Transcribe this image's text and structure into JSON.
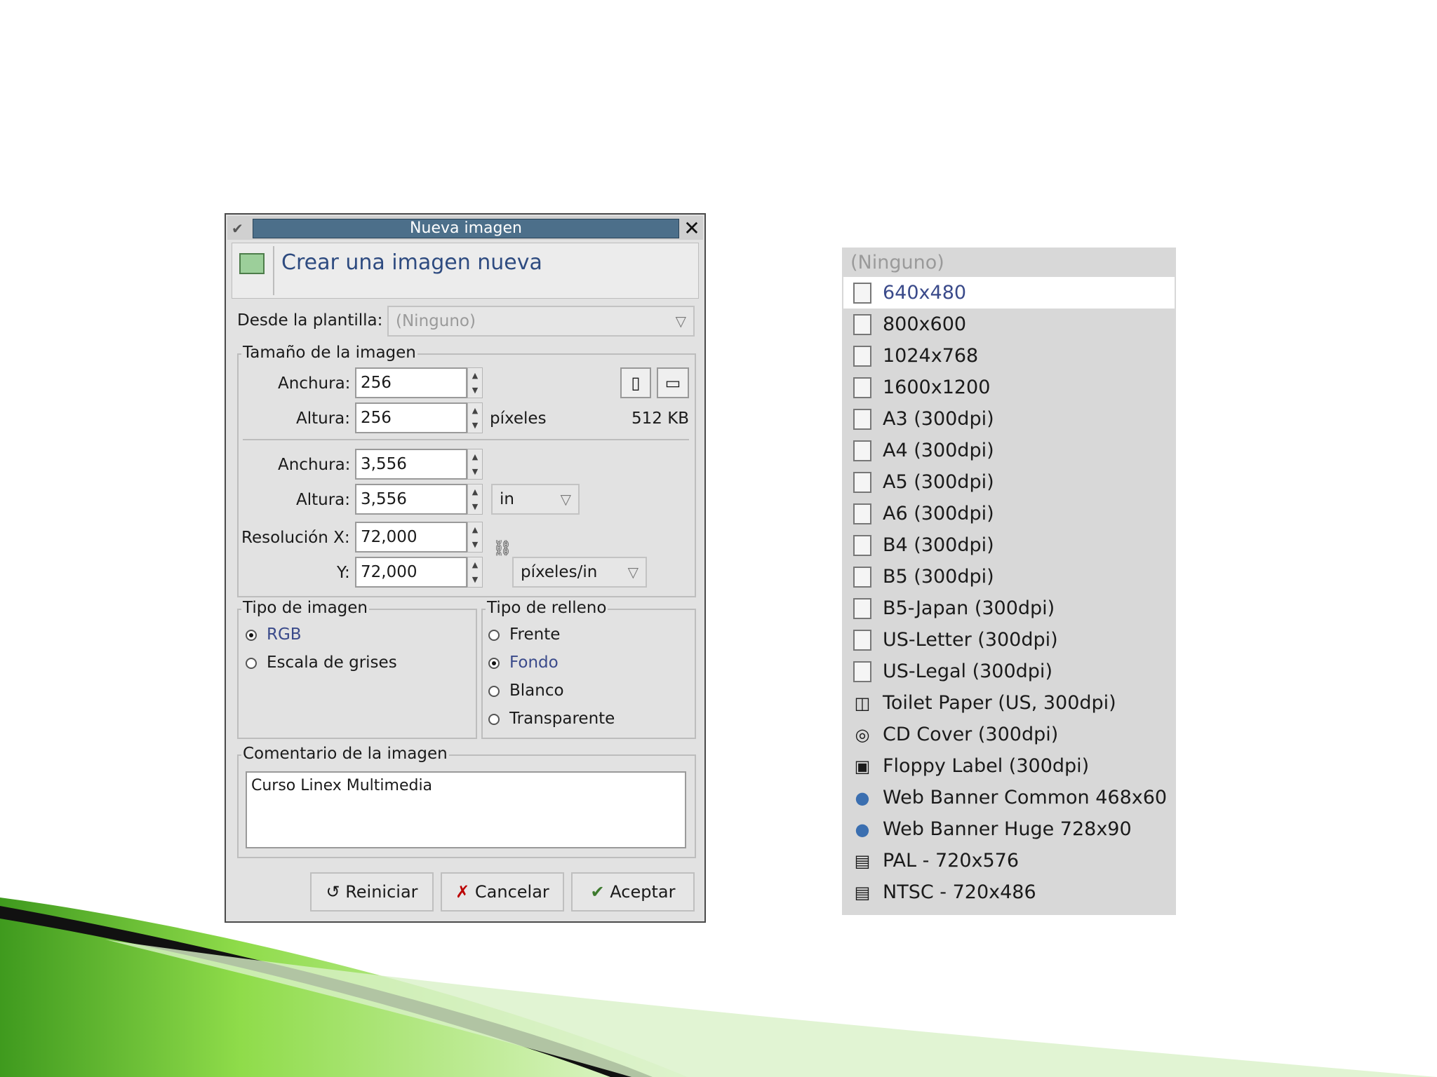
{
  "dialog": {
    "window_title": "Nueva imagen",
    "header_title": "Crear una imagen nueva",
    "template": {
      "label": "Desde la plantilla:",
      "value": "(Ninguno)"
    },
    "size_group": {
      "title": "Tamaño de la imagen",
      "width_label": "Anchura:",
      "width_value": "256",
      "height_label": "Altura:",
      "height_value": "256",
      "pixels_unit": "píxeles",
      "memory": "512 KB",
      "width2_label": "Anchura:",
      "width2_value": "3,556",
      "height2_label": "Altura:",
      "height2_value": "3,556",
      "unit": "in",
      "res_x_label": "Resolución X:",
      "res_x_value": "72,000",
      "res_y_label": "Y:",
      "res_y_value": "72,000",
      "res_unit": "píxeles/in"
    },
    "image_type": {
      "title": "Tipo de imagen",
      "options": [
        "RGB",
        "Escala de grises"
      ],
      "selected": "RGB"
    },
    "fill_type": {
      "title": "Tipo de relleno",
      "options": [
        "Frente",
        "Fondo",
        "Blanco",
        "Transparente"
      ],
      "selected": "Fondo"
    },
    "comment": {
      "title": "Comentario de la imagen",
      "value": "Curso Linex Multimedia"
    },
    "buttons": {
      "reset": "Reiniciar",
      "cancel": "Cancelar",
      "ok": "Aceptar"
    }
  },
  "template_list": {
    "header": "(Ninguno)",
    "selected": "640x480",
    "items": [
      {
        "label": "640x480",
        "icon": "page-icon"
      },
      {
        "label": "800x600",
        "icon": "page-icon"
      },
      {
        "label": "1024x768",
        "icon": "page-icon"
      },
      {
        "label": "1600x1200",
        "icon": "page-icon"
      },
      {
        "label": "A3 (300dpi)",
        "icon": "page-icon"
      },
      {
        "label": "A4 (300dpi)",
        "icon": "page-icon"
      },
      {
        "label": "A5 (300dpi)",
        "icon": "page-icon"
      },
      {
        "label": "A6 (300dpi)",
        "icon": "page-icon"
      },
      {
        "label": "B4 (300dpi)",
        "icon": "page-icon"
      },
      {
        "label": "B5 (300dpi)",
        "icon": "page-icon"
      },
      {
        "label": "B5-Japan (300dpi)",
        "icon": "page-icon"
      },
      {
        "label": "US-Letter (300dpi)",
        "icon": "page-icon"
      },
      {
        "label": "US-Legal (300dpi)",
        "icon": "page-icon"
      },
      {
        "label": "Toilet Paper (US, 300dpi)",
        "icon": "toilet-paper-icon"
      },
      {
        "label": "CD Cover (300dpi)",
        "icon": "cd-icon"
      },
      {
        "label": "Floppy Label (300dpi)",
        "icon": "floppy-icon"
      },
      {
        "label": "Web Banner Common 468x60",
        "icon": "globe-icon"
      },
      {
        "label": "Web Banner Huge 728x90",
        "icon": "globe-icon"
      },
      {
        "label": "PAL - 720x576",
        "icon": "film-icon"
      },
      {
        "label": "NTSC - 720x486",
        "icon": "film-icon"
      }
    ]
  },
  "colors": {
    "title_bar": "#4c6f8a",
    "header_text": "#2e4b80",
    "selected_text": "#3a4a8a"
  }
}
